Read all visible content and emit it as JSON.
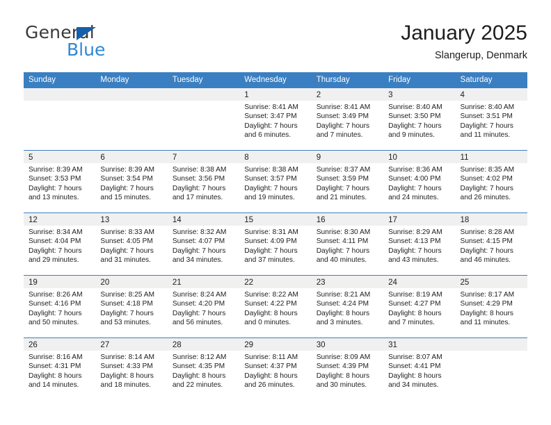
{
  "brand": {
    "word_one": "General",
    "word_two": "Blue",
    "triangle_icon": "brand-triangle-icon",
    "colors": {
      "general_text": "#3a3a3a",
      "blue_text": "#2f87d4",
      "triangle": "#1560ac"
    }
  },
  "header": {
    "title": "January 2025",
    "subtitle": "Slangerup, Denmark"
  },
  "theme": {
    "header_row_bg": "#3a7fc1",
    "cell_header_bg": "#f0f0f0",
    "cell_top_border": "#3a7fc1",
    "text": "#1d1d1d"
  },
  "weekdays": [
    "Sunday",
    "Monday",
    "Tuesday",
    "Wednesday",
    "Thursday",
    "Friday",
    "Saturday"
  ],
  "weeks": [
    [
      {
        "day": "",
        "sunrise": "",
        "sunset": "",
        "daylight_1": "",
        "daylight_2": ""
      },
      {
        "day": "",
        "sunrise": "",
        "sunset": "",
        "daylight_1": "",
        "daylight_2": ""
      },
      {
        "day": "",
        "sunrise": "",
        "sunset": "",
        "daylight_1": "",
        "daylight_2": ""
      },
      {
        "day": "1",
        "sunrise": "Sunrise: 8:41 AM",
        "sunset": "Sunset: 3:47 PM",
        "daylight_1": "Daylight: 7 hours",
        "daylight_2": "and 6 minutes."
      },
      {
        "day": "2",
        "sunrise": "Sunrise: 8:41 AM",
        "sunset": "Sunset: 3:49 PM",
        "daylight_1": "Daylight: 7 hours",
        "daylight_2": "and 7 minutes."
      },
      {
        "day": "3",
        "sunrise": "Sunrise: 8:40 AM",
        "sunset": "Sunset: 3:50 PM",
        "daylight_1": "Daylight: 7 hours",
        "daylight_2": "and 9 minutes."
      },
      {
        "day": "4",
        "sunrise": "Sunrise: 8:40 AM",
        "sunset": "Sunset: 3:51 PM",
        "daylight_1": "Daylight: 7 hours",
        "daylight_2": "and 11 minutes."
      }
    ],
    [
      {
        "day": "5",
        "sunrise": "Sunrise: 8:39 AM",
        "sunset": "Sunset: 3:53 PM",
        "daylight_1": "Daylight: 7 hours",
        "daylight_2": "and 13 minutes."
      },
      {
        "day": "6",
        "sunrise": "Sunrise: 8:39 AM",
        "sunset": "Sunset: 3:54 PM",
        "daylight_1": "Daylight: 7 hours",
        "daylight_2": "and 15 minutes."
      },
      {
        "day": "7",
        "sunrise": "Sunrise: 8:38 AM",
        "sunset": "Sunset: 3:56 PM",
        "daylight_1": "Daylight: 7 hours",
        "daylight_2": "and 17 minutes."
      },
      {
        "day": "8",
        "sunrise": "Sunrise: 8:38 AM",
        "sunset": "Sunset: 3:57 PM",
        "daylight_1": "Daylight: 7 hours",
        "daylight_2": "and 19 minutes."
      },
      {
        "day": "9",
        "sunrise": "Sunrise: 8:37 AM",
        "sunset": "Sunset: 3:59 PM",
        "daylight_1": "Daylight: 7 hours",
        "daylight_2": "and 21 minutes."
      },
      {
        "day": "10",
        "sunrise": "Sunrise: 8:36 AM",
        "sunset": "Sunset: 4:00 PM",
        "daylight_1": "Daylight: 7 hours",
        "daylight_2": "and 24 minutes."
      },
      {
        "day": "11",
        "sunrise": "Sunrise: 8:35 AM",
        "sunset": "Sunset: 4:02 PM",
        "daylight_1": "Daylight: 7 hours",
        "daylight_2": "and 26 minutes."
      }
    ],
    [
      {
        "day": "12",
        "sunrise": "Sunrise: 8:34 AM",
        "sunset": "Sunset: 4:04 PM",
        "daylight_1": "Daylight: 7 hours",
        "daylight_2": "and 29 minutes."
      },
      {
        "day": "13",
        "sunrise": "Sunrise: 8:33 AM",
        "sunset": "Sunset: 4:05 PM",
        "daylight_1": "Daylight: 7 hours",
        "daylight_2": "and 31 minutes."
      },
      {
        "day": "14",
        "sunrise": "Sunrise: 8:32 AM",
        "sunset": "Sunset: 4:07 PM",
        "daylight_1": "Daylight: 7 hours",
        "daylight_2": "and 34 minutes."
      },
      {
        "day": "15",
        "sunrise": "Sunrise: 8:31 AM",
        "sunset": "Sunset: 4:09 PM",
        "daylight_1": "Daylight: 7 hours",
        "daylight_2": "and 37 minutes."
      },
      {
        "day": "16",
        "sunrise": "Sunrise: 8:30 AM",
        "sunset": "Sunset: 4:11 PM",
        "daylight_1": "Daylight: 7 hours",
        "daylight_2": "and 40 minutes."
      },
      {
        "day": "17",
        "sunrise": "Sunrise: 8:29 AM",
        "sunset": "Sunset: 4:13 PM",
        "daylight_1": "Daylight: 7 hours",
        "daylight_2": "and 43 minutes."
      },
      {
        "day": "18",
        "sunrise": "Sunrise: 8:28 AM",
        "sunset": "Sunset: 4:15 PM",
        "daylight_1": "Daylight: 7 hours",
        "daylight_2": "and 46 minutes."
      }
    ],
    [
      {
        "day": "19",
        "sunrise": "Sunrise: 8:26 AM",
        "sunset": "Sunset: 4:16 PM",
        "daylight_1": "Daylight: 7 hours",
        "daylight_2": "and 50 minutes."
      },
      {
        "day": "20",
        "sunrise": "Sunrise: 8:25 AM",
        "sunset": "Sunset: 4:18 PM",
        "daylight_1": "Daylight: 7 hours",
        "daylight_2": "and 53 minutes."
      },
      {
        "day": "21",
        "sunrise": "Sunrise: 8:24 AM",
        "sunset": "Sunset: 4:20 PM",
        "daylight_1": "Daylight: 7 hours",
        "daylight_2": "and 56 minutes."
      },
      {
        "day": "22",
        "sunrise": "Sunrise: 8:22 AM",
        "sunset": "Sunset: 4:22 PM",
        "daylight_1": "Daylight: 8 hours",
        "daylight_2": "and 0 minutes."
      },
      {
        "day": "23",
        "sunrise": "Sunrise: 8:21 AM",
        "sunset": "Sunset: 4:24 PM",
        "daylight_1": "Daylight: 8 hours",
        "daylight_2": "and 3 minutes."
      },
      {
        "day": "24",
        "sunrise": "Sunrise: 8:19 AM",
        "sunset": "Sunset: 4:27 PM",
        "daylight_1": "Daylight: 8 hours",
        "daylight_2": "and 7 minutes."
      },
      {
        "day": "25",
        "sunrise": "Sunrise: 8:17 AM",
        "sunset": "Sunset: 4:29 PM",
        "daylight_1": "Daylight: 8 hours",
        "daylight_2": "and 11 minutes."
      }
    ],
    [
      {
        "day": "26",
        "sunrise": "Sunrise: 8:16 AM",
        "sunset": "Sunset: 4:31 PM",
        "daylight_1": "Daylight: 8 hours",
        "daylight_2": "and 14 minutes."
      },
      {
        "day": "27",
        "sunrise": "Sunrise: 8:14 AM",
        "sunset": "Sunset: 4:33 PM",
        "daylight_1": "Daylight: 8 hours",
        "daylight_2": "and 18 minutes."
      },
      {
        "day": "28",
        "sunrise": "Sunrise: 8:12 AM",
        "sunset": "Sunset: 4:35 PM",
        "daylight_1": "Daylight: 8 hours",
        "daylight_2": "and 22 minutes."
      },
      {
        "day": "29",
        "sunrise": "Sunrise: 8:11 AM",
        "sunset": "Sunset: 4:37 PM",
        "daylight_1": "Daylight: 8 hours",
        "daylight_2": "and 26 minutes."
      },
      {
        "day": "30",
        "sunrise": "Sunrise: 8:09 AM",
        "sunset": "Sunset: 4:39 PM",
        "daylight_1": "Daylight: 8 hours",
        "daylight_2": "and 30 minutes."
      },
      {
        "day": "31",
        "sunrise": "Sunrise: 8:07 AM",
        "sunset": "Sunset: 4:41 PM",
        "daylight_1": "Daylight: 8 hours",
        "daylight_2": "and 34 minutes."
      },
      {
        "day": "",
        "sunrise": "",
        "sunset": "",
        "daylight_1": "",
        "daylight_2": ""
      }
    ]
  ]
}
